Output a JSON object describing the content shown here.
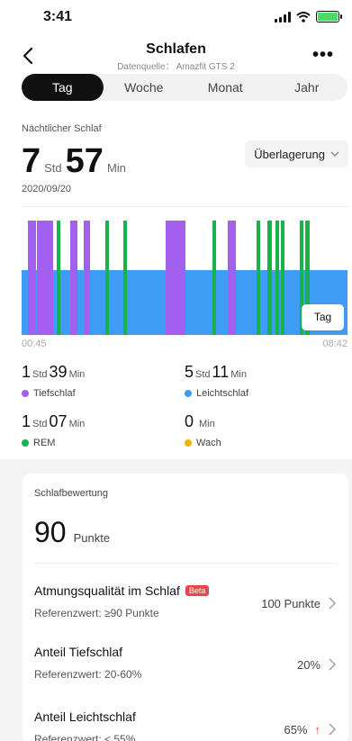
{
  "status": {
    "time": "3:41"
  },
  "header": {
    "title": "Schlafen",
    "subtitle": "Datenquelle： Amazfit GTS 2"
  },
  "tabs": [
    {
      "label": "Tag",
      "active": true
    },
    {
      "label": "Woche",
      "active": false
    },
    {
      "label": "Monat",
      "active": false
    },
    {
      "label": "Jahr",
      "active": false
    }
  ],
  "overnight": {
    "label": "Nächtlicher Schlaf",
    "hours": "7",
    "hours_unit": "Std",
    "minutes": "57",
    "minutes_unit": "Min",
    "date": "2020/09/20",
    "overlay_label": "Überlagerung"
  },
  "chart": {
    "start_time": "00:45",
    "end_time": "08:42",
    "view_button": "Tag",
    "colors": {
      "light": "#3f9cf4",
      "deep": "#a25ff0",
      "rem": "#16b34a"
    },
    "segments": [
      {
        "type": "deep",
        "start": 2.0,
        "end": 4.0
      },
      {
        "type": "deep",
        "start": 5.2,
        "end": 10.3
      },
      {
        "type": "rem",
        "start": 11.0,
        "end": 12.0
      },
      {
        "type": "deep",
        "start": 14.9,
        "end": 17.2
      },
      {
        "type": "rem",
        "start": 19.8,
        "end": 20.8
      },
      {
        "type": "deep",
        "start": 19.0,
        "end": 19.8
      },
      {
        "type": "deep",
        "start": 19.6,
        "end": 21.2
      },
      {
        "type": "deep",
        "start": 19.9,
        "end": 21.5
      },
      {
        "type": "deep",
        "start": 19.9,
        "end": 21.5
      },
      {
        "type": "deep",
        "start": 19.9,
        "end": 21.5
      },
      {
        "type": "deep",
        "start": 19.9,
        "end": 21.5
      },
      {
        "type": "deep",
        "start": 19.9,
        "end": 21.5
      }
    ]
  },
  "stats": [
    {
      "hours": "1",
      "minutes": "39",
      "label": "Tiefschlaf",
      "color": "#a25ff0"
    },
    {
      "hours": "5",
      "minutes": "11",
      "label": "Leichtschlaf",
      "color": "#3f9cf4"
    },
    {
      "hours": "1",
      "minutes": "07",
      "label": "REM",
      "color": "#16b34a"
    },
    {
      "hours": "",
      "minutes": "0",
      "label": "Wach",
      "color": "#f5b301"
    }
  ],
  "units": {
    "std": "Std",
    "min": "Min"
  },
  "score_card": {
    "label": "Schlafbewertung",
    "score": "90",
    "score_unit": "Punkte",
    "rows": [
      {
        "title": "Atmungsqualität im Schlaf",
        "badge": "Beta",
        "ref": "Referenzwert: ≥90 Punkte",
        "value": "100 Punkte"
      },
      {
        "title": "Anteil Tiefschlaf",
        "badge": "",
        "ref": "Referenzwert: 20-60%",
        "value": "20%"
      },
      {
        "title": "Anteil Leichtschlaf",
        "badge": "",
        "ref": "Referenzwert: < 55%",
        "value": "65%",
        "trend": "↑"
      }
    ]
  }
}
